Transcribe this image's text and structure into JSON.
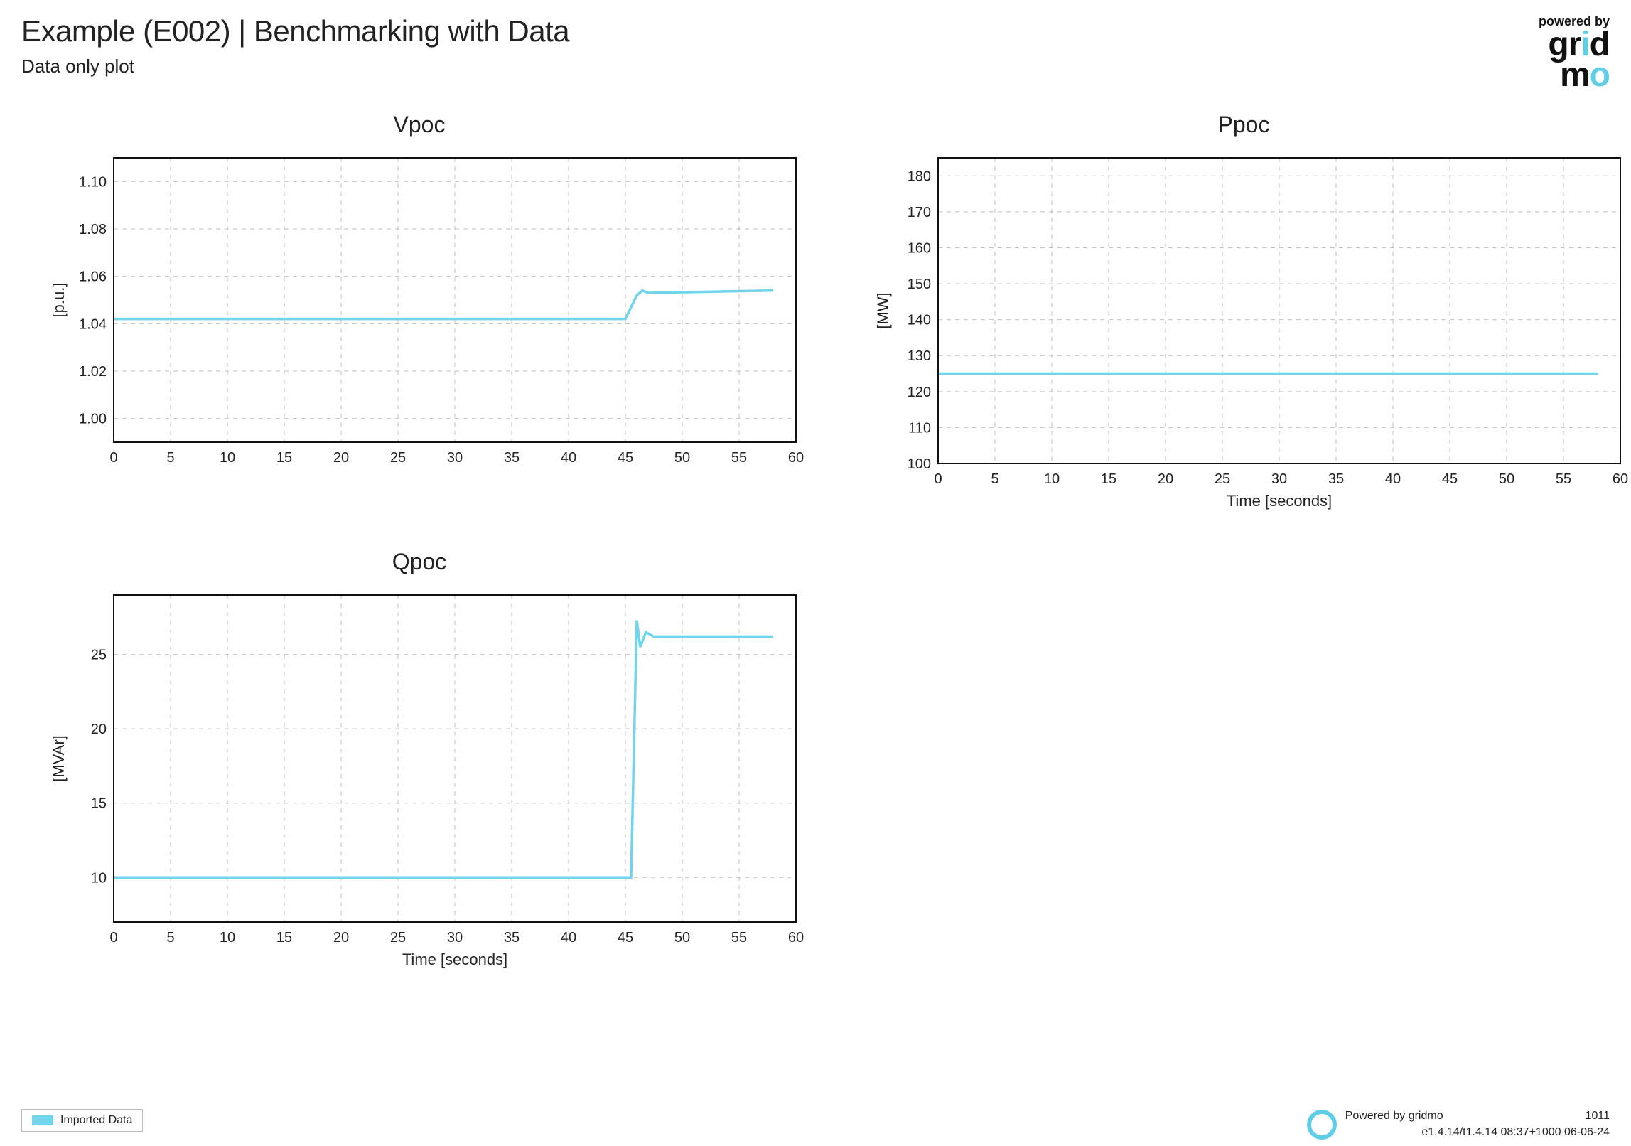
{
  "header": {
    "title": "Example (E002) | Benchmarking with Data",
    "subtitle": "Data only plot",
    "powered_by": "powered by",
    "logo_part1": "gr",
    "logo_i": "i",
    "logo_part2": "d",
    "logo_m": "m",
    "logo_o": "o"
  },
  "charts": {
    "vpoc": {
      "title": "Vpoc",
      "ylabel": "[p.u.]",
      "xlabel": ""
    },
    "ppoc": {
      "title": "Ppoc",
      "ylabel": "[MW]",
      "xlabel": "Time [seconds]"
    },
    "qpoc": {
      "title": "Qpoc",
      "ylabel": "[MVAr]",
      "xlabel": "Time [seconds]"
    }
  },
  "legend": {
    "label": "Imported Data"
  },
  "footer": {
    "powered": "Powered by gridmo",
    "page_num": "1011",
    "version": "e1.4.14/t1.4.14 08:37+1000 06-06-24"
  },
  "colors": {
    "accent": "#5ecde8",
    "line": "#6fd4ec"
  },
  "chart_data": [
    {
      "type": "line",
      "title": "Vpoc",
      "xlabel": "",
      "ylabel": "[p.u.]",
      "series": [
        {
          "name": "Imported Data",
          "x": [
            0,
            45,
            46,
            46.5,
            47,
            58
          ],
          "y": [
            1.042,
            1.042,
            1.052,
            1.054,
            1.053,
            1.054
          ]
        }
      ],
      "xlim": [
        0,
        60
      ],
      "ylim": [
        0.99,
        1.11
      ],
      "xticks": [
        0,
        5,
        10,
        15,
        20,
        25,
        30,
        35,
        40,
        45,
        50,
        55,
        60
      ],
      "yticks": [
        1.0,
        1.02,
        1.04,
        1.06,
        1.08,
        1.1
      ]
    },
    {
      "type": "line",
      "title": "Ppoc",
      "xlabel": "Time [seconds]",
      "ylabel": "[MW]",
      "series": [
        {
          "name": "Imported Data",
          "x": [
            0,
            45,
            47,
            58
          ],
          "y": [
            125,
            125,
            125,
            125
          ]
        }
      ],
      "xlim": [
        0,
        60
      ],
      "ylim": [
        100,
        185
      ],
      "xticks": [
        0,
        5,
        10,
        15,
        20,
        25,
        30,
        35,
        40,
        45,
        50,
        55,
        60
      ],
      "yticks": [
        100,
        110,
        120,
        130,
        140,
        150,
        160,
        170,
        180
      ]
    },
    {
      "type": "line",
      "title": "Qpoc",
      "xlabel": "Time [seconds]",
      "ylabel": "[MVAr]",
      "series": [
        {
          "name": "Imported Data",
          "x": [
            0,
            45,
            45.5,
            46,
            46.3,
            46.8,
            47.5,
            58
          ],
          "y": [
            10,
            10,
            10,
            27.3,
            25.5,
            26.5,
            26.2,
            26.2
          ]
        }
      ],
      "xlim": [
        0,
        60
      ],
      "ylim": [
        7,
        29
      ],
      "xticks": [
        0,
        5,
        10,
        15,
        20,
        25,
        30,
        35,
        40,
        45,
        50,
        55,
        60
      ],
      "yticks": [
        10,
        15,
        20,
        25
      ]
    }
  ]
}
